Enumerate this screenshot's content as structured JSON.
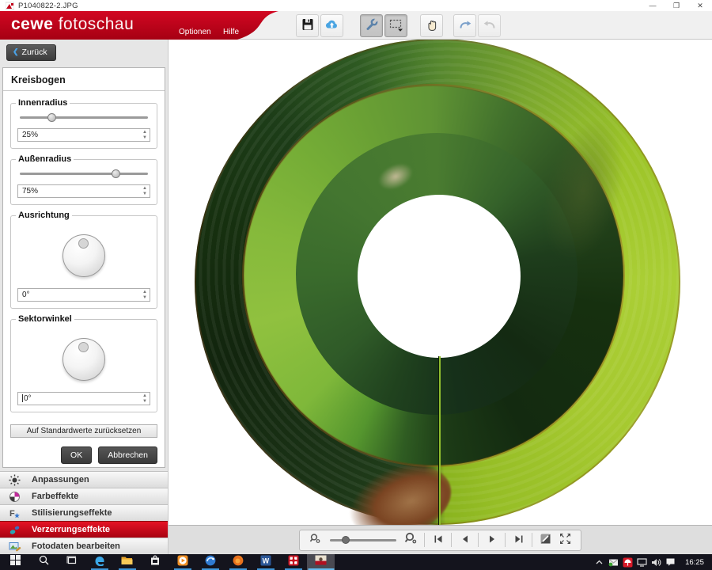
{
  "window": {
    "title": "P1040822-2.JPG",
    "minimize": "—",
    "maximize": "❐",
    "close": "✕"
  },
  "brand": {
    "bold": "cewe",
    "light": "fotoschau",
    "accent_color": "#c3021a"
  },
  "menu": {
    "options": "Optionen",
    "help": "Hilfe"
  },
  "toolbar": {
    "icons": [
      "save-icon",
      "cloud-upload-icon",
      "wrench-tools-icon",
      "rect-select-icon",
      "hand-pan-icon",
      "share-redo-icon",
      "undo-icon"
    ],
    "active_tools": [
      "wrench-tools-icon",
      "rect-select-icon"
    ],
    "disabled_tools": [
      "undo-icon"
    ]
  },
  "sidebar": {
    "back_label": "Zurück",
    "panel_title": "Kreisbogen",
    "inner_radius": {
      "label": "Innenradius",
      "value": "25%",
      "percent": 25
    },
    "outer_radius": {
      "label": "Außenradius",
      "value": "75%",
      "percent": 75
    },
    "orientation": {
      "label": "Ausrichtung",
      "value": "0°"
    },
    "sector_angle": {
      "label": "Sektorwinkel",
      "value": "0°"
    },
    "reset_label": "Auf Standardwerte zurücksetzen",
    "ok_label": "OK",
    "cancel_label": "Abbrechen"
  },
  "accordion": {
    "items": [
      {
        "label": "Anpassungen",
        "icon": "brightness-icon",
        "active": false
      },
      {
        "label": "Farbeffekte",
        "icon": "color-wheel-icon",
        "active": false
      },
      {
        "label": "Stilisierungseffekte",
        "icon": "stylize-star-icon",
        "active": false
      },
      {
        "label": "Verzerrungseffekte",
        "icon": "distort-drops-icon",
        "active": true
      },
      {
        "label": "Fotodaten bearbeiten",
        "icon": "photo-edit-icon",
        "active": false
      }
    ]
  },
  "canvas_toolbar": {
    "icons": [
      "zoom-out-icon",
      "zoom-slider",
      "zoom-in-icon",
      "first-image-icon",
      "prev-image-icon",
      "next-image-icon",
      "last-image-icon",
      "compare-icon",
      "fullscreen-icon"
    ]
  },
  "taskbar": {
    "time": "16:25",
    "apps": [
      "start",
      "search",
      "task-view",
      "edge",
      "file-explorer",
      "store",
      "media-player",
      "cewe-community",
      "firefox",
      "word",
      "cewe-fotowelt",
      "cewe-fotoschau-active"
    ],
    "tray": [
      "tray-expand",
      "mail",
      "antivirus",
      "network",
      "volume",
      "notifications"
    ]
  },
  "colors": {
    "banner_red": "#c3021a",
    "active_item_red": "#d40a1c",
    "taskbar_bg": "#14141d",
    "underline_blue": "#3f96d8"
  }
}
